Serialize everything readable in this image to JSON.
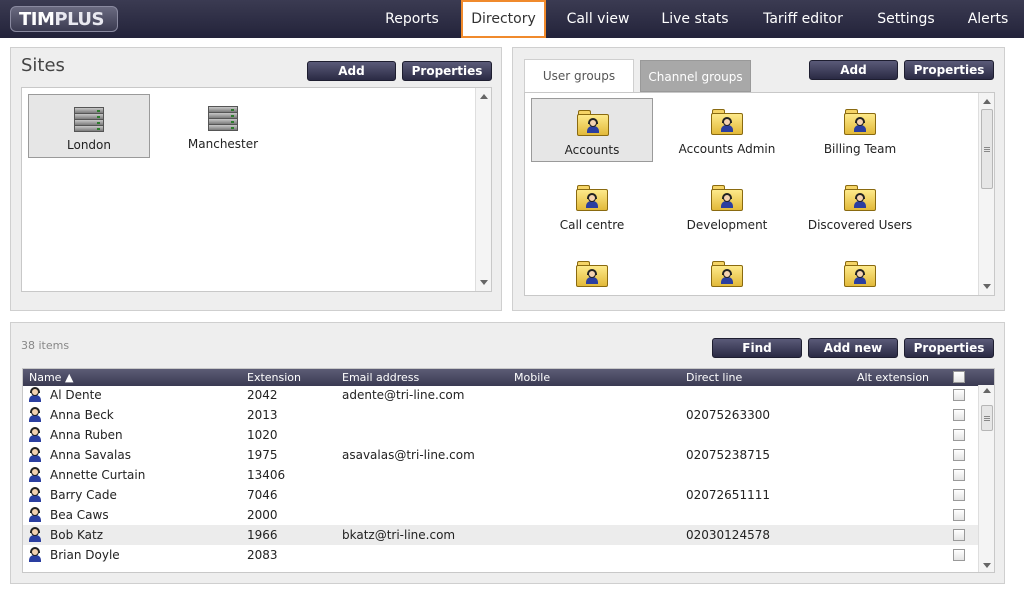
{
  "app": {
    "logo_tim": "TIM",
    "logo_plus": "PLUS"
  },
  "nav": {
    "items": [
      "Reports",
      "Directory",
      "Call view",
      "Live stats",
      "Tariff editor",
      "Settings",
      "Alerts"
    ],
    "active": "Directory"
  },
  "sites": {
    "title": "Sites",
    "add_label": "Add",
    "properties_label": "Properties",
    "items": [
      "London",
      "Manchester"
    ],
    "selected": "London"
  },
  "groups": {
    "tabs": [
      "User groups",
      "Channel groups"
    ],
    "active_tab": "User groups",
    "add_label": "Add",
    "properties_label": "Properties",
    "items": [
      "Accounts",
      "Accounts Admin",
      "Billing Team",
      "Call centre",
      "Development",
      "Discovered Users",
      "",
      "",
      ""
    ],
    "selected": "Accounts"
  },
  "directory": {
    "count_label": "38 items",
    "find_label": "Find",
    "add_new_label": "Add new",
    "properties_label": "Properties",
    "columns": [
      "Name ▲",
      "Extension",
      "Email address",
      "Mobile",
      "Direct line",
      "Alt extension"
    ],
    "rows": [
      {
        "name": "Al Dente",
        "extension": "2042",
        "email": "adente@tri-line.com",
        "mobile": "",
        "direct": "",
        "alt": ""
      },
      {
        "name": "Anna Beck",
        "extension": "2013",
        "email": "",
        "mobile": "",
        "direct": "02075263300",
        "alt": ""
      },
      {
        "name": "Anna Ruben",
        "extension": "1020",
        "email": "",
        "mobile": "",
        "direct": "",
        "alt": ""
      },
      {
        "name": "Anna Savalas",
        "extension": "1975",
        "email": "asavalas@tri-line.com",
        "mobile": "",
        "direct": "02075238715",
        "alt": ""
      },
      {
        "name": "Annette Curtain",
        "extension": "13406",
        "email": "",
        "mobile": "",
        "direct": "",
        "alt": ""
      },
      {
        "name": "Barry Cade",
        "extension": "7046",
        "email": "",
        "mobile": "",
        "direct": "02072651111",
        "alt": ""
      },
      {
        "name": "Bea Caws",
        "extension": "2000",
        "email": "",
        "mobile": "",
        "direct": "",
        "alt": ""
      },
      {
        "name": "Bob Katz",
        "extension": "1966",
        "email": "bkatz@tri-line.com",
        "mobile": "",
        "direct": "02030124578",
        "alt": ""
      },
      {
        "name": "Brian Doyle",
        "extension": "2083",
        "email": "",
        "mobile": "",
        "direct": "",
        "alt": ""
      }
    ],
    "highlighted_row": 7
  },
  "icons": {
    "site": "server-icon",
    "group": "user-folder-icon",
    "user": "user-icon"
  }
}
